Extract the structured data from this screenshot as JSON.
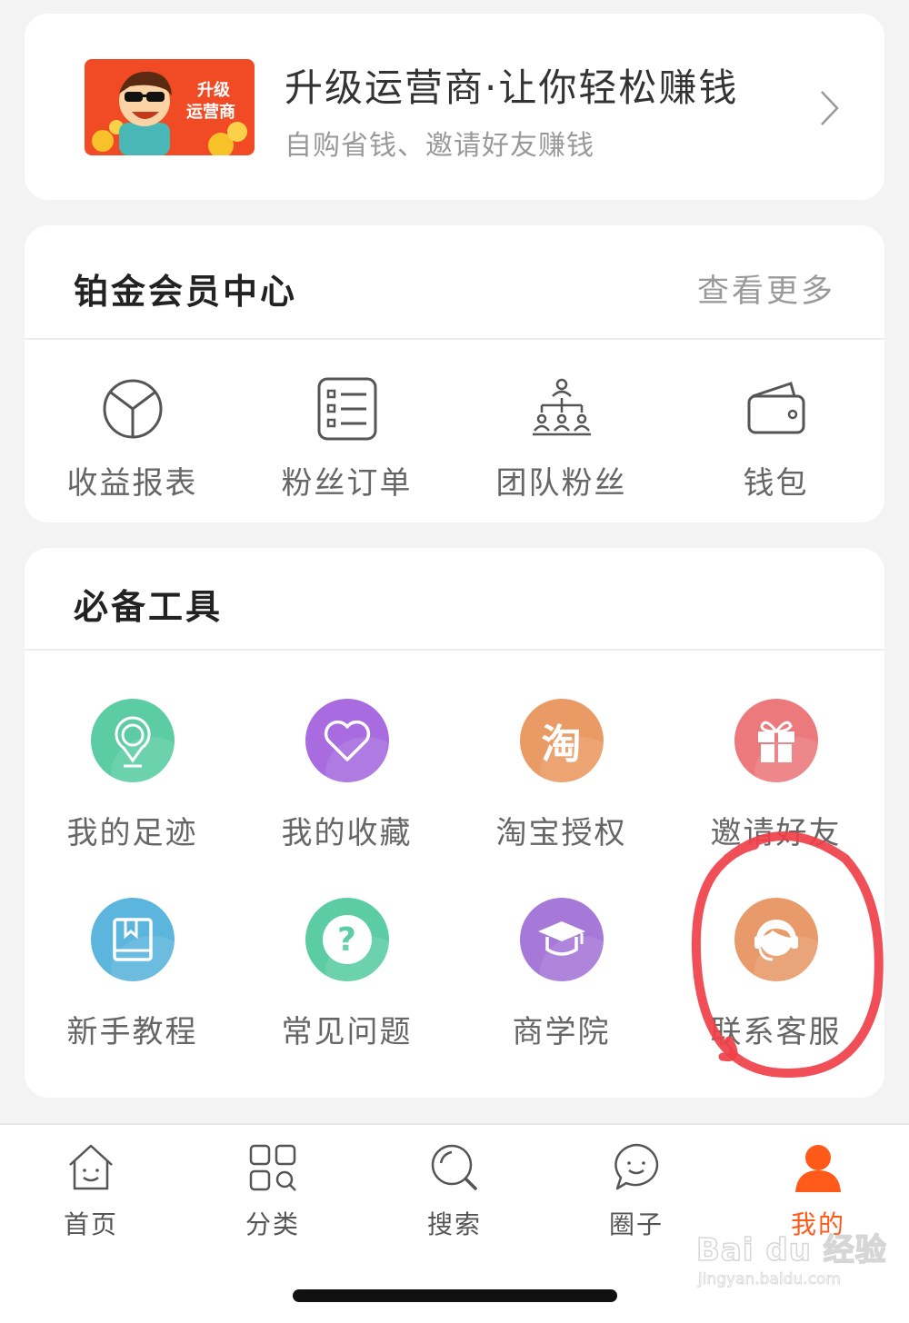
{
  "upgrade": {
    "title": "升级运营商·让你轻松赚钱",
    "subtitle": "自购省钱、邀请好友赚钱",
    "image_text_1": "升级",
    "image_text_2": "运营商"
  },
  "member_center": {
    "title": "铂金会员中心",
    "more": "查看更多",
    "items": [
      {
        "label": "收益报表",
        "icon": "pie-chart-icon"
      },
      {
        "label": "粉丝订单",
        "icon": "list-icon"
      },
      {
        "label": "团队粉丝",
        "icon": "team-tree-icon"
      },
      {
        "label": "钱包",
        "icon": "wallet-icon"
      }
    ]
  },
  "tools": {
    "title": "必备工具",
    "items": [
      {
        "label": "我的足迹",
        "icon": "location-pin-icon",
        "color": "#5ccca4"
      },
      {
        "label": "我的收藏",
        "icon": "heart-icon",
        "color": "#a86be0"
      },
      {
        "label": "淘宝授权",
        "icon": "taobao-icon",
        "icon_text": "淘",
        "color": "#ea9a64"
      },
      {
        "label": "邀请好友",
        "icon": "gift-icon",
        "color": "#ec7a7c"
      },
      {
        "label": "新手教程",
        "icon": "book-icon",
        "color": "#5cb5dc"
      },
      {
        "label": "常见问题",
        "icon": "question-icon",
        "icon_text": "?",
        "color": "#5ccca4"
      },
      {
        "label": "商学院",
        "icon": "graduation-cap-icon",
        "color": "#a678d8"
      },
      {
        "label": "联系客服",
        "icon": "customer-service-icon",
        "color": "#e89a6a"
      }
    ]
  },
  "tabbar": {
    "tabs": [
      {
        "label": "首页",
        "icon": "home-icon"
      },
      {
        "label": "分类",
        "icon": "category-icon"
      },
      {
        "label": "搜索",
        "icon": "search-icon"
      },
      {
        "label": "圈子",
        "icon": "chat-bubble-icon"
      },
      {
        "label": "我的",
        "icon": "person-icon",
        "active": true
      }
    ],
    "active_color": "#ff5a1a"
  },
  "watermark": {
    "text": "Bai du 经验",
    "sub": "jingyan.baidu.com"
  },
  "colors": {
    "annotation_circle": "#f0404a"
  }
}
